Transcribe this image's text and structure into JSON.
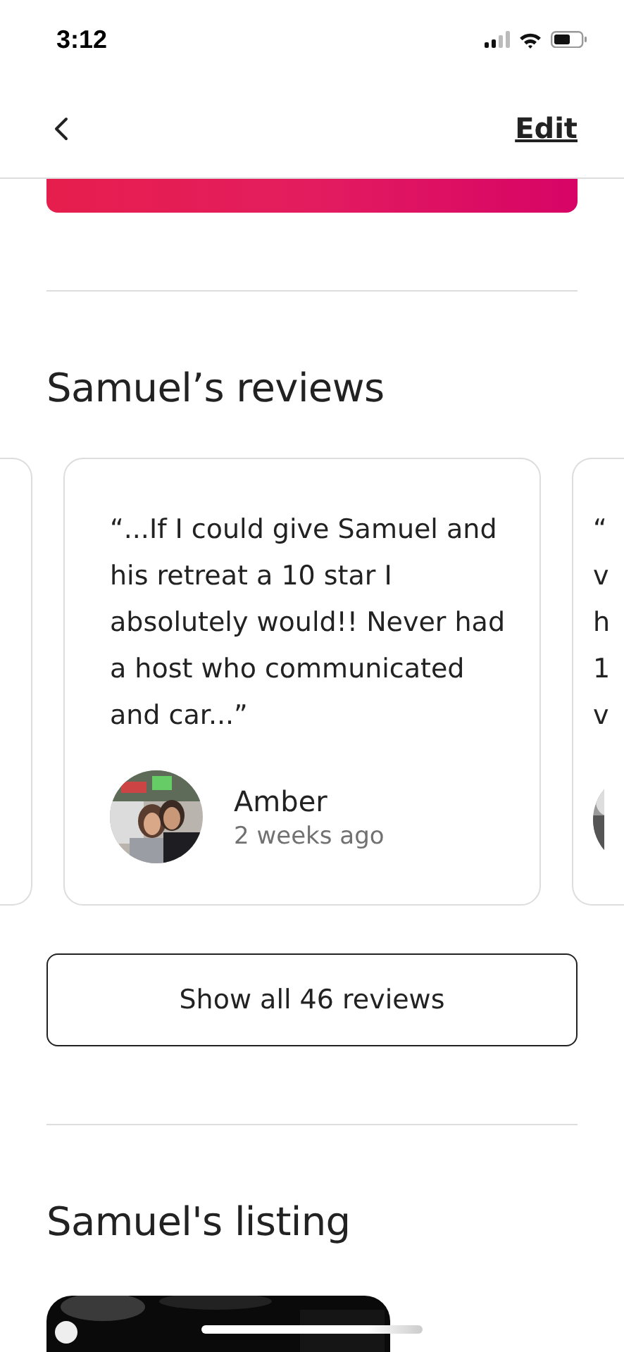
{
  "status_bar": {
    "time": "3:12"
  },
  "nav": {
    "action": "Edit"
  },
  "reviews": {
    "title": "Samuel’s reviews",
    "cards": [
      {
        "quote": "“...If I could give Samuel and his retreat a 10 star I absolutely would!! Never had a host who communicated and car...”",
        "author": "Amber",
        "time": "2 weeks ago"
      }
    ],
    "next_card_lines": [
      "“",
      "v",
      "h",
      "1",
      "v"
    ],
    "show_all": "Show all 46 reviews"
  },
  "listing": {
    "title": "Samuel's listing"
  }
}
